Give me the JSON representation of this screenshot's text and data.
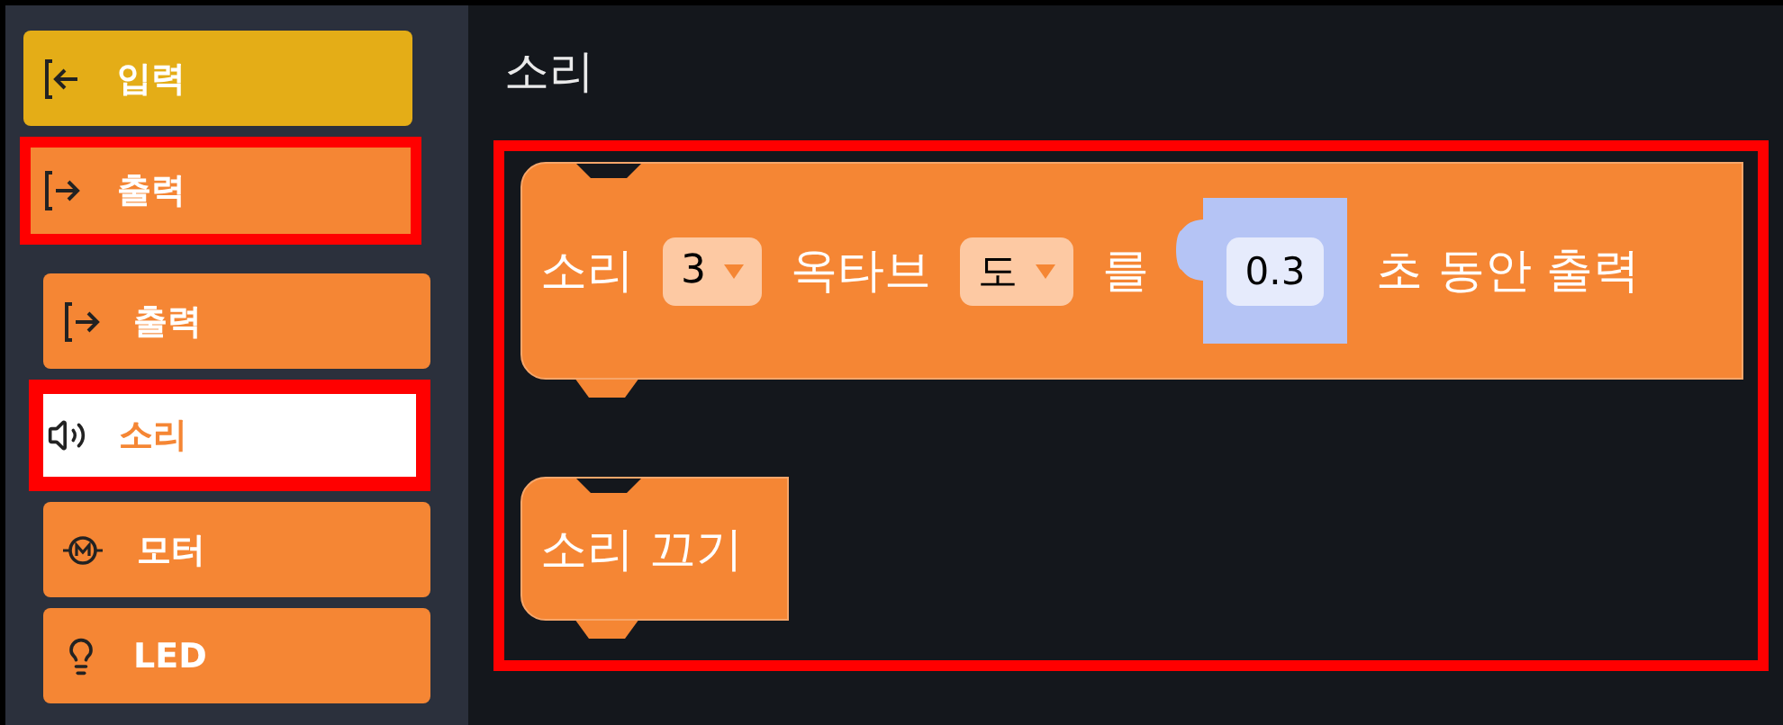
{
  "sidebar": {
    "categories": [
      {
        "label": "입력",
        "color": "#e4ad17",
        "highlighted": false
      },
      {
        "label": "출력",
        "color": "#f58634",
        "highlighted": true
      }
    ],
    "items": [
      {
        "label": "출력",
        "selected": false,
        "highlighted": false
      },
      {
        "label": "소리",
        "selected": true,
        "highlighted": true
      },
      {
        "label": "모터",
        "selected": false,
        "highlighted": false
      },
      {
        "label": "LED",
        "selected": false,
        "highlighted": false
      }
    ]
  },
  "workspace": {
    "title": "소리",
    "highlighted": true,
    "blocks": [
      {
        "parts": [
          {
            "kind": "text",
            "text": "소리"
          },
          {
            "kind": "dropdown",
            "value": "3"
          },
          {
            "kind": "text",
            "text": "옥타브"
          },
          {
            "kind": "dropdown",
            "value": "도"
          },
          {
            "kind": "text",
            "text": "를"
          },
          {
            "kind": "number",
            "value": "0.3"
          },
          {
            "kind": "text",
            "text": "초 동안 출력"
          }
        ]
      },
      {
        "parts": [
          {
            "kind": "text",
            "text": "소리 끄기"
          }
        ]
      }
    ]
  }
}
